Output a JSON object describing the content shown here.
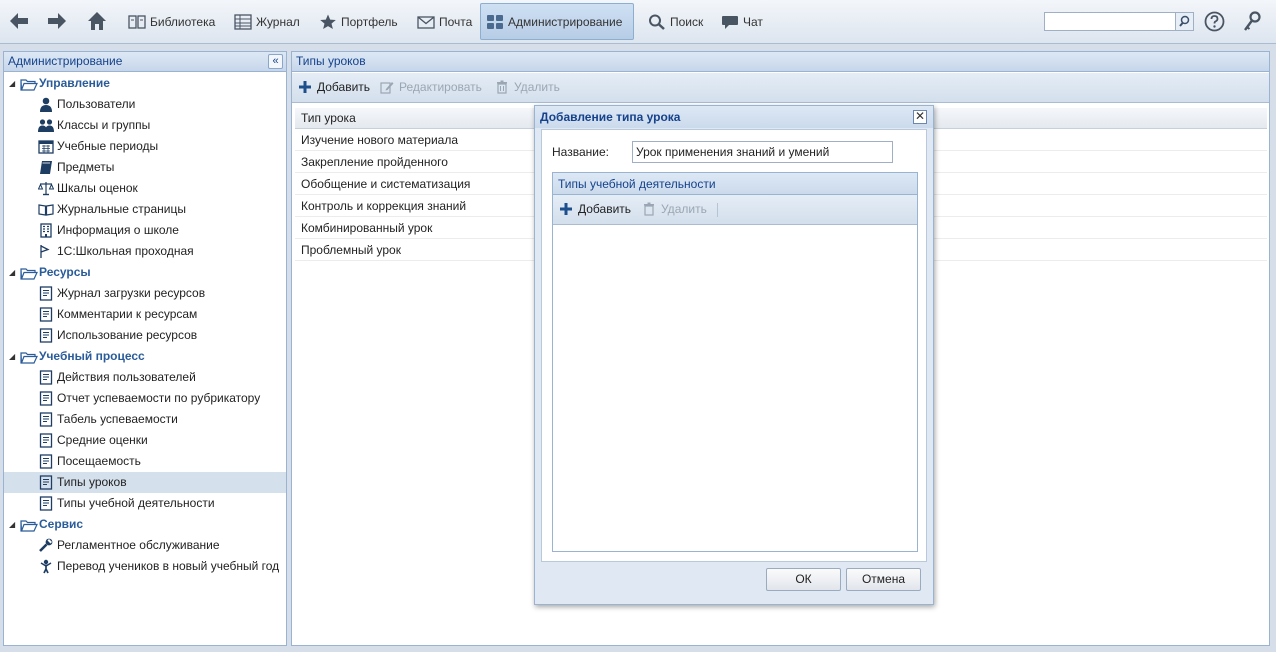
{
  "topbar": {
    "nav": [
      {
        "id": "library",
        "label": "Библиотека",
        "icon": "book-icon"
      },
      {
        "id": "journal",
        "label": "Журнал",
        "icon": "journal-icon"
      },
      {
        "id": "portfolio",
        "label": "Портфель",
        "icon": "star-icon"
      },
      {
        "id": "mail",
        "label": "Почта",
        "icon": "envelope-icon"
      },
      {
        "id": "admin",
        "label": "Администрирование",
        "icon": "admin-icon",
        "active": true
      },
      {
        "id": "search",
        "label": "Поиск",
        "icon": "magnifier-icon"
      },
      {
        "id": "chat",
        "label": "Чат",
        "icon": "chat-bubble-icon"
      }
    ],
    "search_value": ""
  },
  "left": {
    "title": "Администрирование",
    "groups": [
      {
        "label": "Управление",
        "items": [
          {
            "label": "Пользователи",
            "icon": "user-icon"
          },
          {
            "label": "Классы и группы",
            "icon": "users-group-icon"
          },
          {
            "label": "Учебные периоды",
            "icon": "calendar-icon"
          },
          {
            "label": "Предметы",
            "icon": "book-icon"
          },
          {
            "label": "Шкалы оценок",
            "icon": "scales-icon"
          },
          {
            "label": "Журнальные страницы",
            "icon": "open-book-icon"
          },
          {
            "label": "Информация о школе",
            "icon": "building-icon"
          },
          {
            "label": "1С:Школьная проходная",
            "icon": "flag-icon"
          }
        ]
      },
      {
        "label": "Ресурсы",
        "items": [
          {
            "label": "Журнал загрузки ресурсов",
            "icon": "report-icon"
          },
          {
            "label": "Комментарии к ресурсам",
            "icon": "report-icon"
          },
          {
            "label": "Использование ресурсов",
            "icon": "report-icon"
          }
        ]
      },
      {
        "label": "Учебный процесс",
        "items": [
          {
            "label": "Действия пользователей",
            "icon": "report-icon"
          },
          {
            "label": "Отчет успеваемости по рубрикатору",
            "icon": "report-icon"
          },
          {
            "label": "Табель успеваемости",
            "icon": "report-icon"
          },
          {
            "label": "Средние оценки",
            "icon": "report-icon"
          },
          {
            "label": "Посещаемость",
            "icon": "report-icon"
          },
          {
            "label": "Типы уроков",
            "icon": "report-icon",
            "selected": true
          },
          {
            "label": "Типы учебной деятельности",
            "icon": "report-icon"
          }
        ]
      },
      {
        "label": "Сервис",
        "items": [
          {
            "label": "Регламентное обслуживание",
            "icon": "wrench-icon"
          },
          {
            "label": "Перевод учеников в новый учебный год",
            "icon": "person-up-icon"
          }
        ]
      }
    ]
  },
  "main": {
    "title": "Типы уроков",
    "toolbar": {
      "add": "Добавить",
      "edit": "Редактировать",
      "delete": "Удалить"
    },
    "column": "Тип урока",
    "rows": [
      "Изучение нового материала",
      "Закрепление пройденного",
      "Обобщение и систематизация",
      "Контроль и коррекция знаний",
      "Комбинированный урок",
      "Проблемный урок"
    ]
  },
  "modal": {
    "title": "Добавление типа урока",
    "name_label": "Название:",
    "name_value": "Урок применения знаний и умений",
    "subpanel_title": "Типы учебной деятельности",
    "add": "Добавить",
    "delete": "Удалить",
    "ok": "ОК",
    "cancel": "Отмена"
  },
  "colors": {
    "accent": "#15428b",
    "panel_header": "#c6d6ea",
    "selection": "#d5e0ed",
    "background": "#d5dee9"
  }
}
